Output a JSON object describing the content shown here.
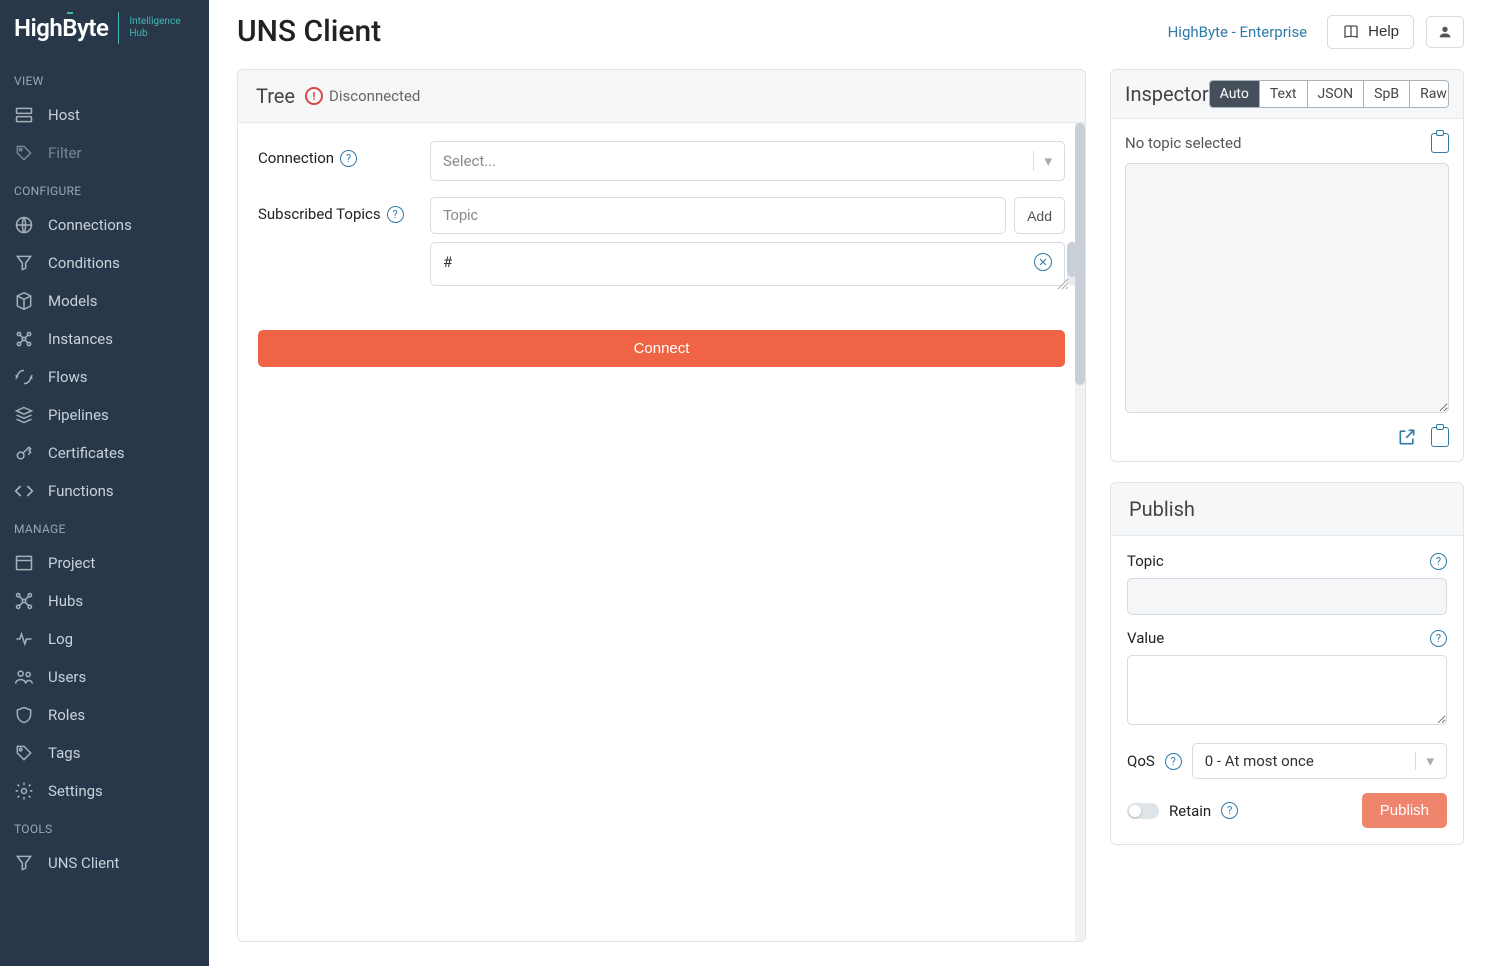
{
  "brand": {
    "name": "HighByte",
    "sub1": "Intelligence",
    "sub2": "Hub"
  },
  "sidebar": {
    "sections": {
      "view": {
        "label": "VIEW",
        "items": [
          {
            "label": "Host",
            "icon": "host"
          },
          {
            "label": "Filter",
            "icon": "tag",
            "dim": true
          }
        ]
      },
      "configure": {
        "label": "CONFIGURE",
        "items": [
          {
            "label": "Connections",
            "icon": "globe"
          },
          {
            "label": "Conditions",
            "icon": "funnel"
          },
          {
            "label": "Models",
            "icon": "cube"
          },
          {
            "label": "Instances",
            "icon": "instances"
          },
          {
            "label": "Flows",
            "icon": "flows"
          },
          {
            "label": "Pipelines",
            "icon": "layers"
          },
          {
            "label": "Certificates",
            "icon": "key"
          },
          {
            "label": "Functions",
            "icon": "code"
          }
        ]
      },
      "manage": {
        "label": "MANAGE",
        "items": [
          {
            "label": "Project",
            "icon": "project"
          },
          {
            "label": "Hubs",
            "icon": "hubs"
          },
          {
            "label": "Log",
            "icon": "log"
          },
          {
            "label": "Users",
            "icon": "users"
          },
          {
            "label": "Roles",
            "icon": "shield"
          },
          {
            "label": "Tags",
            "icon": "tag"
          },
          {
            "label": "Settings",
            "icon": "gear"
          }
        ]
      },
      "tools": {
        "label": "TOOLS",
        "items": [
          {
            "label": "UNS Client",
            "icon": "uns"
          }
        ]
      }
    }
  },
  "topbar": {
    "title": "UNS Client",
    "link": "HighByte - Enterprise",
    "help": "Help"
  },
  "tree": {
    "title": "Tree",
    "status": "Disconnected",
    "connection_label": "Connection",
    "connection_placeholder": "Select...",
    "subscribed_label": "Subscribed Topics",
    "topic_placeholder": "Topic",
    "add_label": "Add",
    "topics": [
      "#"
    ],
    "connect_label": "Connect"
  },
  "inspector": {
    "title": "Inspector",
    "tabs": [
      "Auto",
      "Text",
      "JSON",
      "SpB",
      "Raw"
    ],
    "active_tab": "Auto",
    "no_topic": "No topic selected"
  },
  "publish": {
    "title": "Publish",
    "topic_label": "Topic",
    "value_label": "Value",
    "qos_label": "QoS",
    "qos_value": "0 - At most once",
    "retain_label": "Retain",
    "publish_label": "Publish"
  }
}
